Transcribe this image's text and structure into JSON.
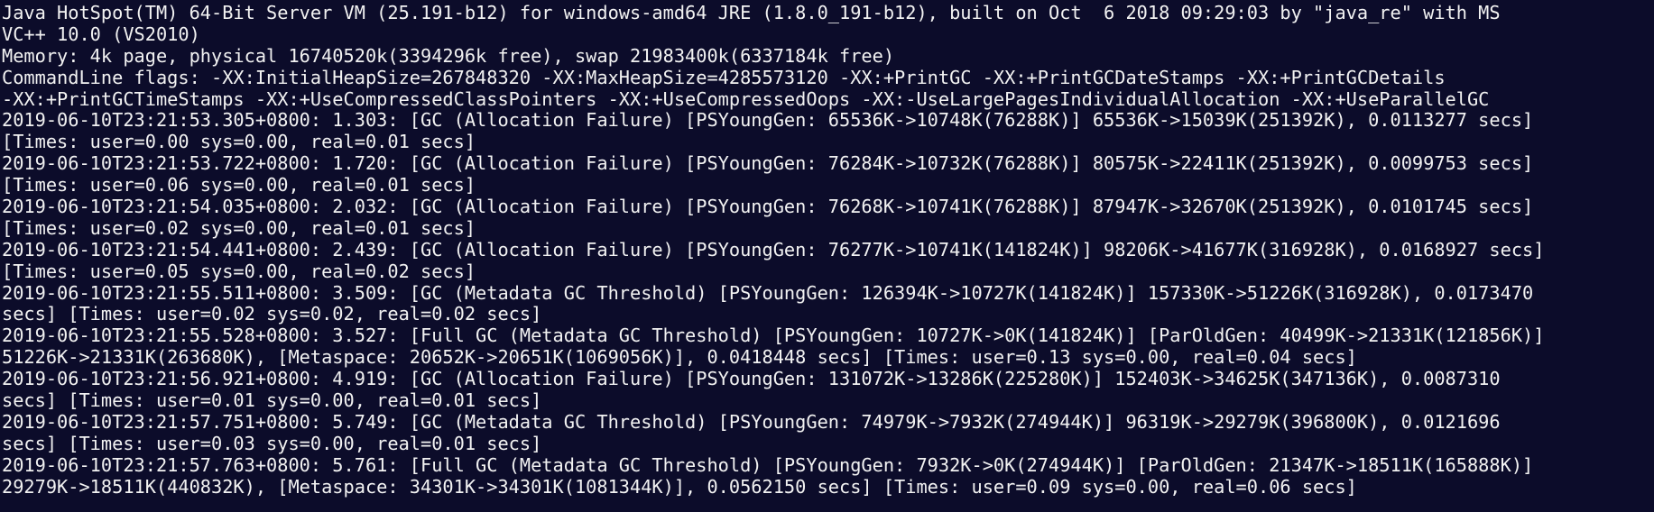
{
  "terminal": {
    "lines": [
      "Java HotSpot(TM) 64-Bit Server VM (25.191-b12) for windows-amd64 JRE (1.8.0_191-b12), built on Oct  6 2018 09:29:03 by \"java_re\" with MS",
      "VC++ 10.0 (VS2010)",
      "Memory: 4k page, physical 16740520k(3394296k free), swap 21983400k(6337184k free)",
      "CommandLine flags: -XX:InitialHeapSize=267848320 -XX:MaxHeapSize=4285573120 -XX:+PrintGC -XX:+PrintGCDateStamps -XX:+PrintGCDetails",
      "-XX:+PrintGCTimeStamps -XX:+UseCompressedClassPointers -XX:+UseCompressedOops -XX:-UseLargePagesIndividualAllocation -XX:+UseParallelGC",
      "2019-06-10T23:21:53.305+0800: 1.303: [GC (Allocation Failure) [PSYoungGen: 65536K->10748K(76288K)] 65536K->15039K(251392K), 0.0113277 secs]",
      "[Times: user=0.00 sys=0.00, real=0.01 secs]",
      "2019-06-10T23:21:53.722+0800: 1.720: [GC (Allocation Failure) [PSYoungGen: 76284K->10732K(76288K)] 80575K->22411K(251392K), 0.0099753 secs]",
      "[Times: user=0.06 sys=0.00, real=0.01 secs]",
      "2019-06-10T23:21:54.035+0800: 2.032: [GC (Allocation Failure) [PSYoungGen: 76268K->10741K(76288K)] 87947K->32670K(251392K), 0.0101745 secs]",
      "[Times: user=0.02 sys=0.00, real=0.01 secs]",
      "2019-06-10T23:21:54.441+0800: 2.439: [GC (Allocation Failure) [PSYoungGen: 76277K->10741K(141824K)] 98206K->41677K(316928K), 0.0168927 secs]",
      "[Times: user=0.05 sys=0.00, real=0.02 secs]",
      "2019-06-10T23:21:55.511+0800: 3.509: [GC (Metadata GC Threshold) [PSYoungGen: 126394K->10727K(141824K)] 157330K->51226K(316928K), 0.0173470",
      "secs] [Times: user=0.02 sys=0.02, real=0.02 secs]",
      "2019-06-10T23:21:55.528+0800: 3.527: [Full GC (Metadata GC Threshold) [PSYoungGen: 10727K->0K(141824K)] [ParOldGen: 40499K->21331K(121856K)]",
      "51226K->21331K(263680K), [Metaspace: 20652K->20651K(1069056K)], 0.0418448 secs] [Times: user=0.13 sys=0.00, real=0.04 secs]",
      "2019-06-10T23:21:56.921+0800: 4.919: [GC (Allocation Failure) [PSYoungGen: 131072K->13286K(225280K)] 152403K->34625K(347136K), 0.0087310",
      "secs] [Times: user=0.01 sys=0.00, real=0.01 secs]",
      "2019-06-10T23:21:57.751+0800: 5.749: [GC (Metadata GC Threshold) [PSYoungGen: 74979K->7932K(274944K)] 96319K->29279K(396800K), 0.0121696",
      "secs] [Times: user=0.03 sys=0.00, real=0.01 secs]",
      "2019-06-10T23:21:57.763+0800: 5.761: [Full GC (Metadata GC Threshold) [PSYoungGen: 7932K->0K(274944K)] [ParOldGen: 21347K->18511K(165888K)]",
      "29279K->18511K(440832K), [Metaspace: 34301K->34301K(1081344K)], 0.0562150 secs] [Times: user=0.09 sys=0.00, real=0.06 secs]"
    ]
  },
  "colors": {
    "background": "#0c0c2a",
    "text": "#f2f2f2"
  }
}
